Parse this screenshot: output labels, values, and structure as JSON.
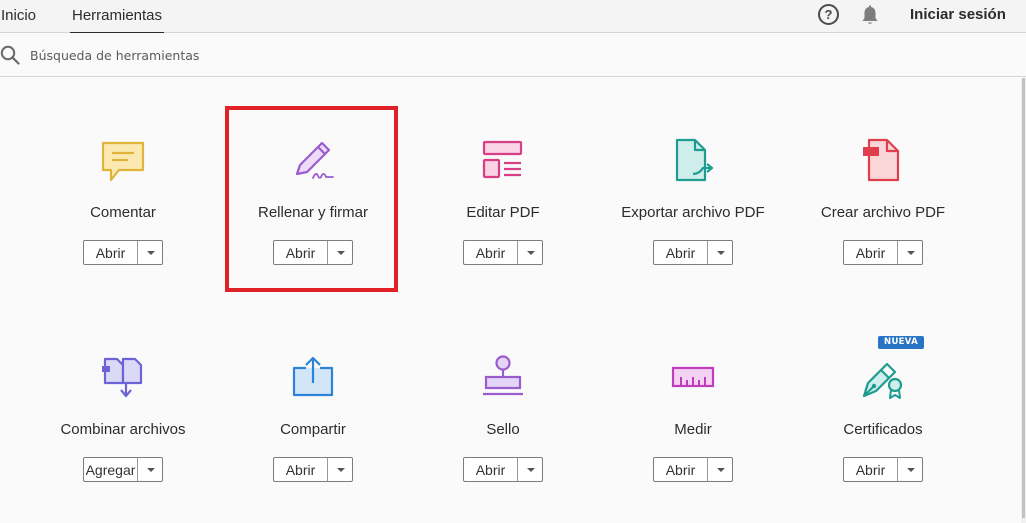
{
  "nav": {
    "tabs": [
      {
        "label": "Inicio"
      },
      {
        "label": "Herramientas"
      }
    ],
    "help_label": "?",
    "sign_in": "Iniciar sesión"
  },
  "search": {
    "placeholder": "Búsqueda de herramientas"
  },
  "tools": [
    {
      "name": "Comentar",
      "action": "Abrir",
      "icon": "comment-icon",
      "color": "#e0b43a"
    },
    {
      "name": "Rellenar y firmar",
      "action": "Abrir",
      "icon": "fill-sign-icon",
      "color": "#9a5ccf",
      "highlighted": true
    },
    {
      "name": "Editar PDF",
      "action": "Abrir",
      "icon": "edit-pdf-icon",
      "color": "#d63f86"
    },
    {
      "name": "Exportar archivo PDF",
      "action": "Abrir",
      "icon": "export-pdf-icon",
      "color": "#1f9c90"
    },
    {
      "name": "Crear archivo PDF",
      "action": "Abrir",
      "icon": "create-pdf-icon",
      "color": "#df3e4d"
    },
    {
      "name": "Combinar archivos",
      "action": "Agregar",
      "icon": "combine-files-icon",
      "color": "#6b63d6"
    },
    {
      "name": "Compartir",
      "action": "Abrir",
      "icon": "share-icon",
      "color": "#2d84d6"
    },
    {
      "name": "Sello",
      "action": "Abrir",
      "icon": "stamp-icon",
      "color": "#9a5ccf"
    },
    {
      "name": "Medir",
      "action": "Abrir",
      "icon": "measure-icon",
      "color": "#c03dbe"
    },
    {
      "name": "Certificados",
      "action": "Abrir",
      "icon": "certificates-icon",
      "color": "#1f9c90",
      "badge": "NUEVA"
    }
  ],
  "colors": {
    "highlight": "#e02128",
    "badge": "#2a74c5"
  }
}
